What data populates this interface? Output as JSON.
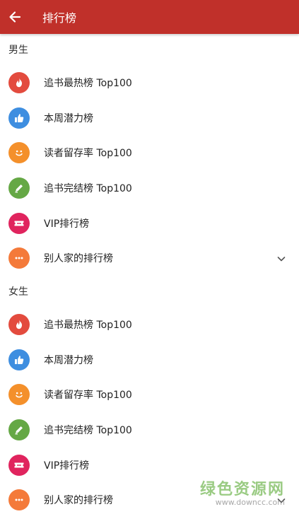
{
  "appbar": {
    "title": "排行榜"
  },
  "sections": [
    {
      "header": "男生",
      "items": [
        {
          "label": "追书最热榜 Top100",
          "icon": "flame-icon",
          "color": "#e34b3e"
        },
        {
          "label": "本周潜力榜",
          "icon": "thumbs-up-icon",
          "color": "#3e8ee0"
        },
        {
          "label": "读者留存率 Top100",
          "icon": "smiley-icon",
          "color": "#f4902b"
        },
        {
          "label": "追书完结榜 Top100",
          "icon": "pen-icon",
          "color": "#65a845"
        },
        {
          "label": "VIP排行榜",
          "icon": "ticket-icon",
          "color": "#e0245e"
        },
        {
          "label": "别人家的排行榜",
          "icon": "more-dots-icon",
          "color": "#f47a3a",
          "expandable": true
        }
      ]
    },
    {
      "header": "女生",
      "items": [
        {
          "label": "追书最热榜 Top100",
          "icon": "flame-icon",
          "color": "#e34b3e"
        },
        {
          "label": "本周潜力榜",
          "icon": "thumbs-up-icon",
          "color": "#3e8ee0"
        },
        {
          "label": "读者留存率 Top100",
          "icon": "smiley-icon",
          "color": "#f4902b"
        },
        {
          "label": "追书完结榜 Top100",
          "icon": "pen-icon",
          "color": "#65a845"
        },
        {
          "label": "VIP排行榜",
          "icon": "ticket-icon",
          "color": "#e0245e"
        },
        {
          "label": "别人家的排行榜",
          "icon": "more-dots-icon",
          "color": "#f47a3a",
          "expandable": true
        }
      ]
    }
  ],
  "watermark": {
    "main": "绿色资源网",
    "url": "www.downcc.com"
  }
}
